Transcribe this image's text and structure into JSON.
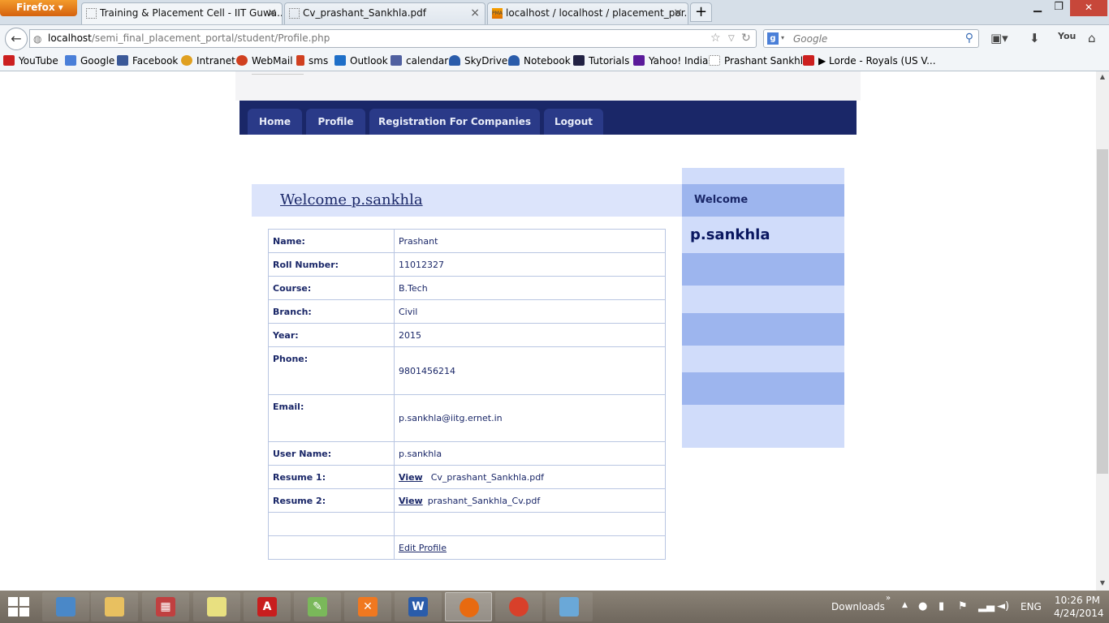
{
  "browser": {
    "menu_button": "Firefox",
    "tabs": [
      {
        "title": "Training & Placement Cell - IIT Guwa...",
        "active": true
      },
      {
        "title": "Cv_prashant_Sankhla.pdf",
        "active": false
      },
      {
        "title": "localhost / localhost / placement_por...",
        "active": false
      }
    ],
    "new_tab": "+",
    "url_host": "localhost",
    "url_path": "/semi_final_placement_portal/student/Profile.php",
    "search_engine_letter": "g",
    "search_placeholder": "Google",
    "bookmarks": [
      {
        "label": "YouTube",
        "icon": "youtube-icon",
        "color": "#cc1f1f"
      },
      {
        "label": "Google",
        "icon": "google-icon",
        "color": "#4a7fd8"
      },
      {
        "label": "Facebook",
        "icon": "facebook-icon",
        "color": "#3b5998"
      },
      {
        "label": "Intranet",
        "icon": "intranet-icon",
        "color": "#e0a020"
      },
      {
        "label": "WebMail",
        "icon": "webmail-icon",
        "color": "#d04020"
      },
      {
        "label": "sms",
        "icon": "sms-icon",
        "color": "#d04020"
      },
      {
        "label": "Outlook",
        "icon": "outlook-icon",
        "color": "#1e6fc8"
      },
      {
        "label": "calendar",
        "icon": "calendar-icon",
        "color": "#5060a0"
      },
      {
        "label": "SkyDrive",
        "icon": "skydrive-icon",
        "color": "#2a5caa"
      },
      {
        "label": "Notebook",
        "icon": "notebook-icon",
        "color": "#2a5caa"
      },
      {
        "label": "Tutorials",
        "icon": "tutorials-icon",
        "color": "#222244"
      },
      {
        "label": "Yahoo! India",
        "icon": "yahoo-icon",
        "color": "#5a1a9a"
      },
      {
        "label": "Prashant Sankhla",
        "icon": "page-icon",
        "color": "#ffffff"
      },
      {
        "label": "▶ Lorde - Royals (US V...",
        "icon": "youtube-icon",
        "color": "#cc1f1f"
      }
    ]
  },
  "site": {
    "menu": [
      "Home",
      "Profile",
      "Registration For Companies",
      "Logout"
    ],
    "welcome_heading": "Welcome p.sankhla",
    "sidebar_title": "Welcome",
    "sidebar_user": "p.sankhla"
  },
  "profile": {
    "rows": [
      {
        "key": "Name:",
        "value": "Prashant"
      },
      {
        "key": "Roll Number:",
        "value": "11012327"
      },
      {
        "key": "Course:",
        "value": "B.Tech"
      },
      {
        "key": "Branch:",
        "value": "Civil"
      },
      {
        "key": "Year:",
        "value": "2015"
      },
      {
        "key": "Phone:",
        "value": "9801456214"
      },
      {
        "key": "Email:",
        "value": "p.sankhla@iitg.ernet.in"
      },
      {
        "key": "User Name:",
        "value": "p.sankhla"
      }
    ],
    "resume1_label": "Resume 1:",
    "resume1_link": "View",
    "resume1_file": "Cv_prashant_Sankhla.pdf",
    "resume2_label": "Resume 2:",
    "resume2_link": "View",
    "resume2_file": "prashant_Sankhla_Cv.pdf",
    "edit_link": "Edit Profile"
  },
  "taskbar": {
    "downloads_label": "Downloads",
    "language": "ENG",
    "time": "10:26 PM",
    "date": "4/24/2014"
  },
  "colors": {
    "menu_bg": "#1a2768",
    "menu_tab": "#2a3a88",
    "welcome_bg": "#dce4fb",
    "sidebar_light": "#d0dcfa",
    "sidebar_dark": "#9db5ee",
    "text_navy": "#1a2768"
  }
}
